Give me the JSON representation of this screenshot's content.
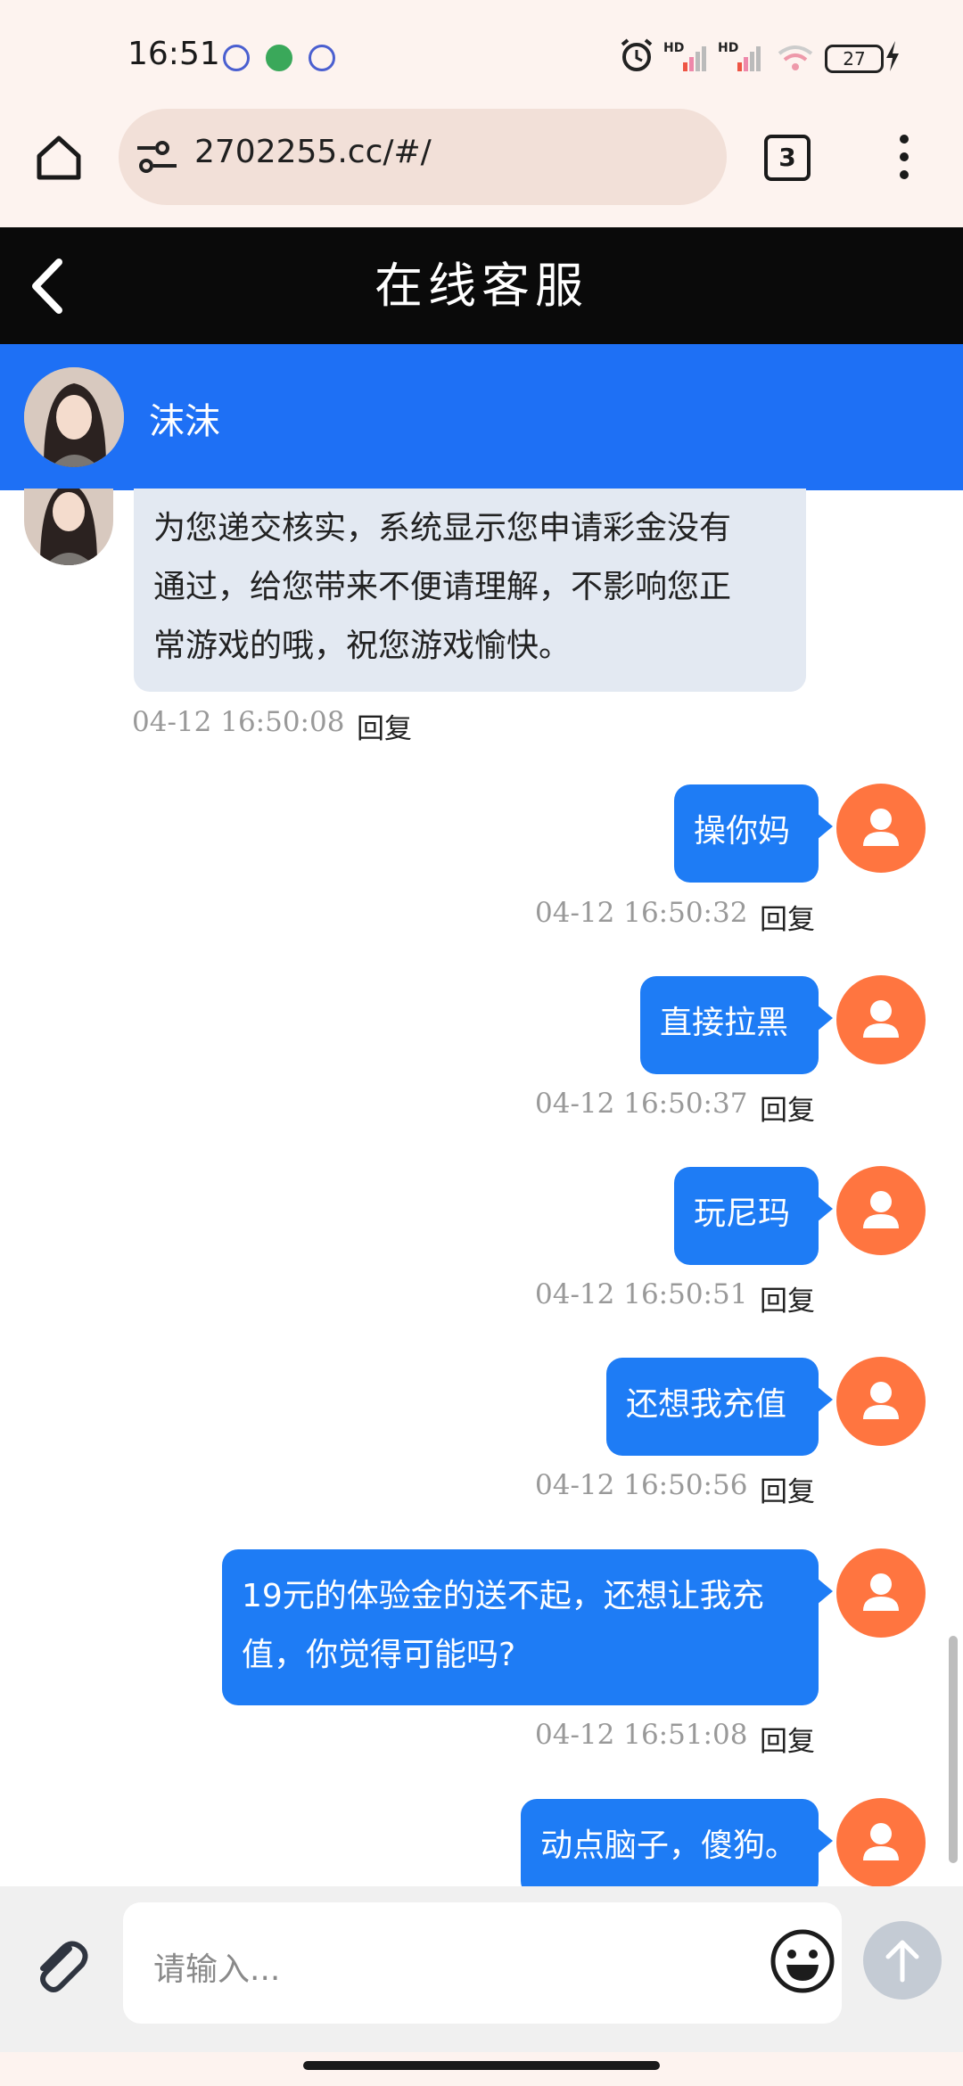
{
  "status_bar": {
    "time": "16:51",
    "network": "HD",
    "battery": "27"
  },
  "browser": {
    "url": "2702255.cc/#/",
    "tab_count": "3"
  },
  "page": {
    "title": "在线客服"
  },
  "agent": {
    "name": "沫沫"
  },
  "messages": [
    {
      "sender": "agent",
      "lines": [
        "为您递交核实，系统显示您申请彩金没有",
        "通过，给您带来不便请理解，不影响您正",
        "常游戏的哦，祝您游戏愉快。"
      ],
      "time": "04-12 16:50:08",
      "reply": "回复"
    },
    {
      "sender": "user",
      "text": "操你妈",
      "time": "04-12 16:50:32",
      "reply": "回复"
    },
    {
      "sender": "user",
      "text": "直接拉黑",
      "time": "04-12 16:50:37",
      "reply": "回复"
    },
    {
      "sender": "user",
      "text": "玩尼玛",
      "time": "04-12 16:50:51",
      "reply": "回复"
    },
    {
      "sender": "user",
      "text": "还想我充值",
      "time": "04-12 16:50:56",
      "reply": "回复"
    },
    {
      "sender": "user",
      "lines": [
        "19元的体验金的送不起，还想让我充",
        "值，你觉得可能吗?"
      ],
      "time": "04-12 16:51:08",
      "reply": "回复"
    },
    {
      "sender": "user",
      "text": "动点脑子，傻狗。"
    }
  ],
  "input": {
    "placeholder": "请输入..."
  },
  "colors": {
    "accent_blue": "#1e70f5",
    "user_bubble": "#1e7cf5",
    "agent_bubble": "#e3e9f2",
    "user_avatar": "#ff7540",
    "title_bar": "#0a0a0a"
  },
  "icons": [
    "home-icon",
    "site-settings-icon",
    "more-vert-icon",
    "back-arrow-icon",
    "attachment-icon",
    "emoji-icon",
    "send-arrow-icon",
    "user-icon"
  ]
}
